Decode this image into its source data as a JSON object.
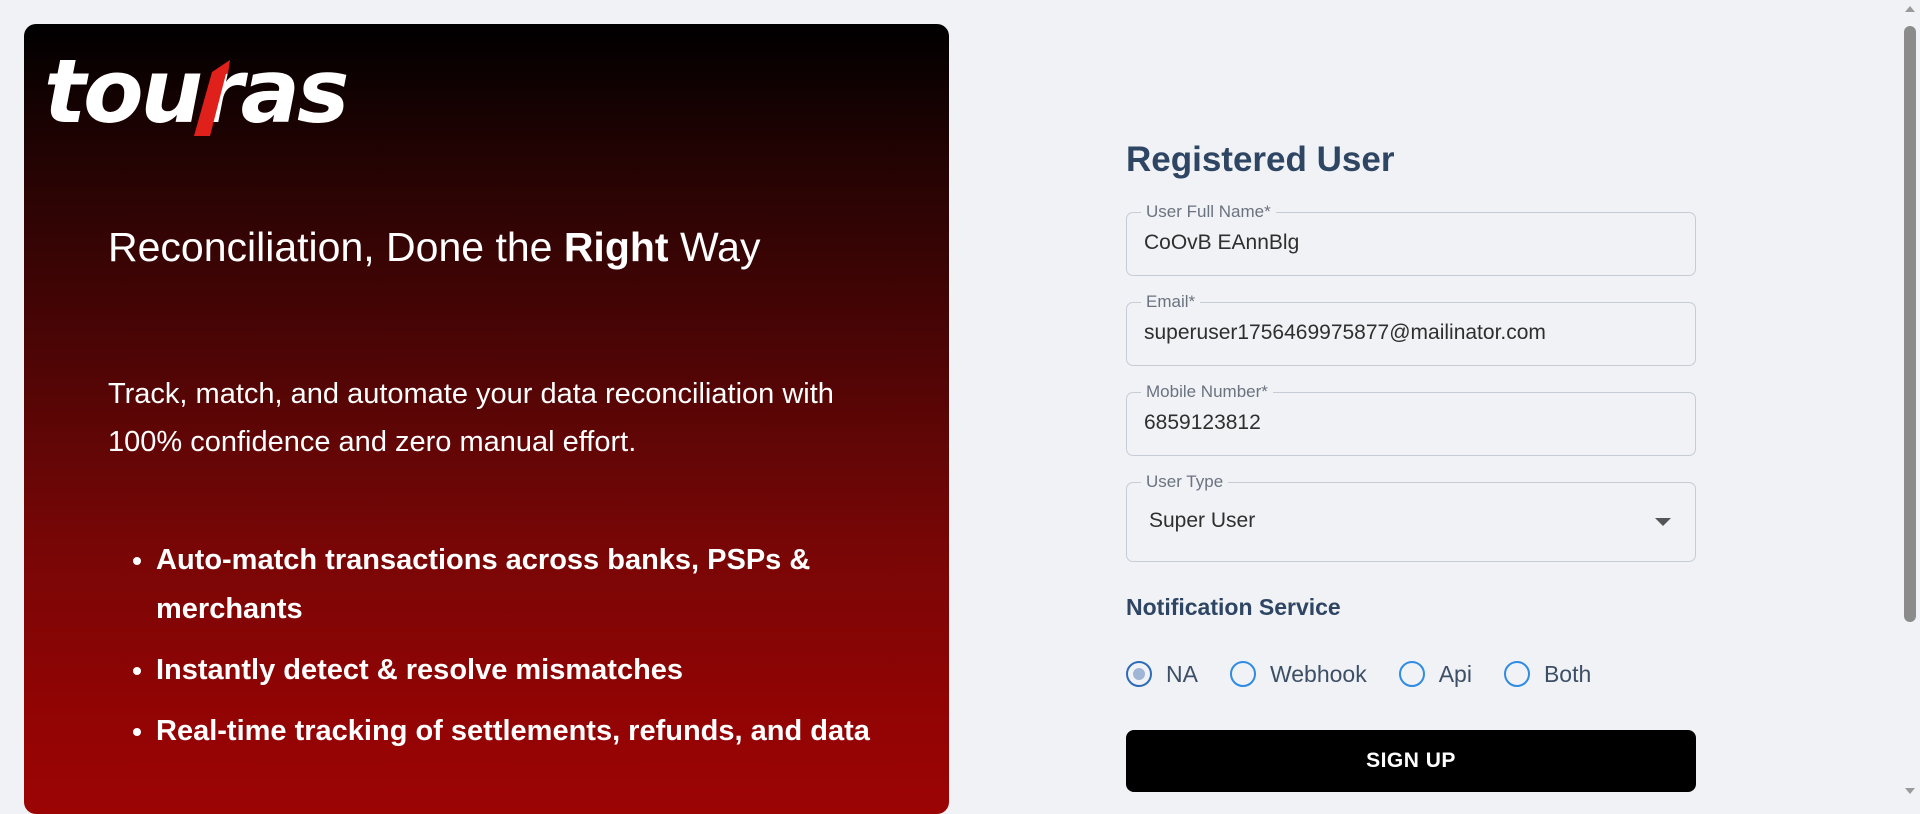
{
  "brand": {
    "logo_text": "touras"
  },
  "hero": {
    "headline_pre": "Reconciliation, Done the ",
    "headline_bold": "Right",
    "headline_post": " Way",
    "subtext": "Track, match, and automate your data reconciliation with 100% confidence and zero manual effort.",
    "features": [
      "Auto-match transactions across banks, PSPs & merchants",
      "Instantly detect & resolve mismatches",
      "Real-time tracking of settlements, refunds, and data"
    ]
  },
  "form": {
    "title": "Registered User",
    "full_name": {
      "label": "User Full Name*",
      "value": "CoOvB EAnnBlg"
    },
    "email": {
      "label": "Email*",
      "value": "superuser1756469975877@mailinator.com"
    },
    "mobile": {
      "label": "Mobile Number*",
      "value": "6859123812"
    },
    "user_type": {
      "label": "User Type",
      "value": "Super User"
    },
    "notification_label": "Notification Service",
    "notification_options": [
      "NA",
      "Webhook",
      "Api",
      "Both"
    ],
    "notification_selected": "NA",
    "submit_label": "SIGN UP"
  },
  "colors": {
    "accent_red": "#e0201b",
    "title_navy": "#2e4563",
    "radio_blue": "#2f8be4",
    "button_black": "#000000"
  }
}
